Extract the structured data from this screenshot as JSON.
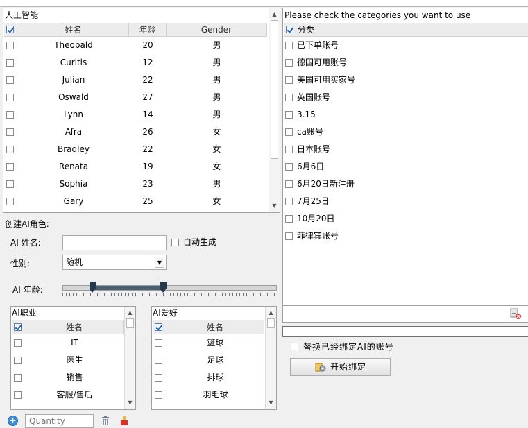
{
  "ai_table": {
    "title": "人工智能",
    "headers": [
      "姓名",
      "年龄",
      "Gender"
    ],
    "rows": [
      {
        "name": "Theobald",
        "age": "20",
        "gender": "男"
      },
      {
        "name": "Curitis",
        "age": "12",
        "gender": "男"
      },
      {
        "name": "Julian",
        "age": "22",
        "gender": "男"
      },
      {
        "name": "Oswald",
        "age": "27",
        "gender": "男"
      },
      {
        "name": "Lynn",
        "age": "14",
        "gender": "男"
      },
      {
        "name": "Afra",
        "age": "26",
        "gender": "女"
      },
      {
        "name": "Bradley",
        "age": "22",
        "gender": "女"
      },
      {
        "name": "Renata",
        "age": "19",
        "gender": "女"
      },
      {
        "name": "Sophia",
        "age": "23",
        "gender": "男"
      },
      {
        "name": "Gary",
        "age": "25",
        "gender": "女"
      }
    ]
  },
  "create": {
    "title": "创建AI角色:",
    "name_label": "AI 姓名:",
    "name_value": "",
    "auto_label": "自动生成",
    "gender_label": "性别:",
    "gender_value": "随机",
    "age_label": "AI 年龄:",
    "age_range_fraction": [
      0.14,
      0.47
    ]
  },
  "job_list": {
    "title": "AI职业",
    "header": "姓名",
    "items": [
      "IT",
      "医生",
      "销售",
      "客服/售后"
    ]
  },
  "hobby_list": {
    "title": "AI爱好",
    "header": "姓名",
    "items": [
      "篮球",
      "足球",
      "排球",
      "羽毛球"
    ]
  },
  "footer": {
    "quantity_placeholder": "Quantity",
    "add_icon": "add-icon",
    "trash_icon": "trash-icon",
    "brush_icon": "brush-icon"
  },
  "categories": {
    "title": "Please check the categories you want to use",
    "header": "分类",
    "items": [
      "已下单账号",
      "德国可用账号",
      "美国可用买家号",
      "英国账号",
      "3.15",
      "ca账号",
      "日本账号",
      "6月6日",
      "6月20日新注册",
      "7月25日",
      "10月20日",
      "菲律宾账号"
    ]
  },
  "binding": {
    "delete_icon": "delete-icon",
    "replace_label": "替换已经绑定AI的账号",
    "start_label": "开始绑定",
    "start_icon": "bind-icon"
  }
}
